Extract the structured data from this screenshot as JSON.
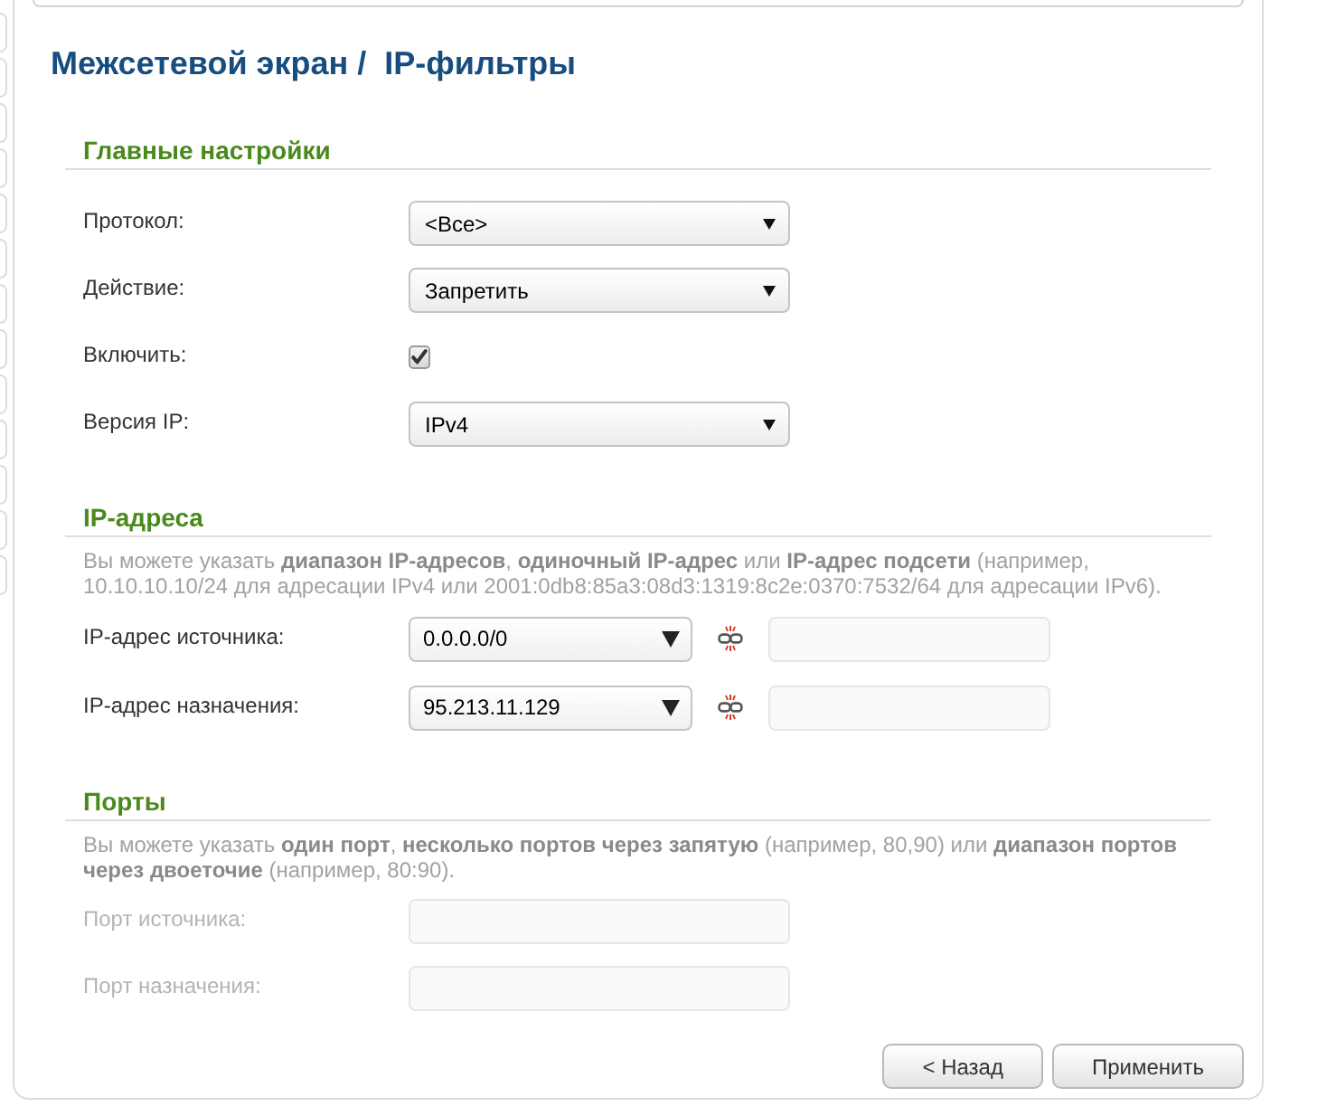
{
  "title": "Межсетевой экран /  IP-фильтры",
  "sections": [
    {
      "heading": "Главные настройки",
      "rows": [
        {
          "kind": "select",
          "label": "Протокол:",
          "value": "<Все>"
        },
        {
          "kind": "select",
          "label": "Действие:",
          "value": "Запретить"
        },
        {
          "kind": "checkbox",
          "label": "Включить:",
          "checked": true
        },
        {
          "kind": "select",
          "label": "Версия IP:",
          "value": "IPv4"
        }
      ]
    },
    {
      "heading": "IP-адреса",
      "description": "Вы можете указать **диапазон IP-адресов**, **одиночный IP-адрес** или **IP-адрес подсети** (например, 10.10.10.10/24 для адресации IPv4 или 2001:0db8:85a3:08d3:1319:8c2e:0370:7532/64 для адресации IPv6).",
      "rows": [
        {
          "kind": "address",
          "label": "IP-адрес источника:",
          "value": "0.0.0.0/0",
          "field_disabled": true
        },
        {
          "kind": "address",
          "label": "IP-адрес назначения:",
          "value": "95.213.11.129",
          "field_disabled": true
        }
      ]
    },
    {
      "heading": "Порты",
      "description": "Вы можете указать **один порт**, **несколько портов через запятую** (например, 80,90) или **диапазон портов через двоеточие** (например, 80:90).",
      "rows": [
        {
          "kind": "text",
          "label": "Порт источника:",
          "disabled": true
        },
        {
          "kind": "text",
          "label": "Порт назначения:",
          "disabled": true
        }
      ]
    }
  ],
  "buttons": [
    {
      "label": "< Назад"
    },
    {
      "label": "Применить"
    }
  ]
}
